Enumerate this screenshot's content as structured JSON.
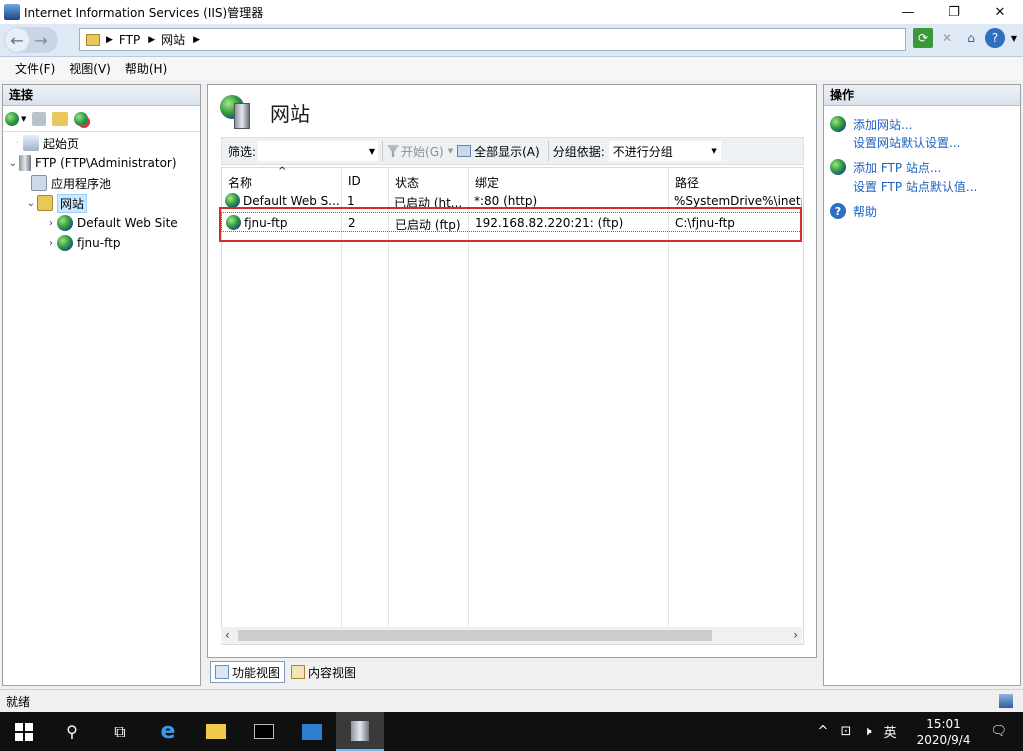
{
  "window": {
    "title": "Internet Information Services (IIS)管理器",
    "controls": {
      "minimize": "—",
      "maximize": "❐",
      "close": "✕"
    }
  },
  "address": {
    "crumbs": [
      "FTP",
      "网站"
    ]
  },
  "menu": {
    "items": [
      "文件(F)",
      "视图(V)",
      "帮助(H)"
    ]
  },
  "connections": {
    "header": "连接",
    "tree": [
      {
        "label": "起始页",
        "level": 1,
        "expander": "",
        "icon": "start-page-icon"
      },
      {
        "label": "FTP (FTP\\Administrator)",
        "level": 0,
        "expander": "⌄",
        "icon": "server-icon"
      },
      {
        "label": "应用程序池",
        "level": 2,
        "expander": "",
        "icon": "app-pool-icon"
      },
      {
        "label": "网站",
        "level": 1,
        "expander": "⌄",
        "icon": "sites-folder-icon",
        "selected": true
      },
      {
        "label": "Default Web Site",
        "level": 2,
        "expander": "›",
        "icon": "globe-icon"
      },
      {
        "label": "fjnu-ftp",
        "level": 2,
        "expander": "›",
        "icon": "globe-icon"
      }
    ]
  },
  "center": {
    "title": "网站",
    "filter": {
      "label": "筛选:",
      "start_label": "开始(G)",
      "show_all_label": "全部显示(A)",
      "group_label": "分组依据:",
      "group_value": "不进行分组"
    },
    "columns": [
      "名称",
      "ID",
      "状态",
      "绑定",
      "路径"
    ],
    "rows": [
      {
        "name": "Default Web S...",
        "id": "1",
        "status": "已启动 (ht...",
        "binding": "*:80 (http)",
        "path": "%SystemDrive%\\inetpu"
      },
      {
        "name": "fjnu-ftp",
        "id": "2",
        "status": "已启动 (ftp)",
        "binding": "192.168.82.220:21: (ftp)",
        "path": "C:\\fjnu-ftp"
      }
    ],
    "view_tabs": [
      "功能视图",
      "内容视图"
    ]
  },
  "actions": {
    "header": "操作",
    "items": [
      {
        "label": "添加网站...",
        "icon": "add-site-icon"
      },
      {
        "label": "设置网站默认设置...",
        "icon": ""
      },
      {
        "label": "添加 FTP 站点...",
        "icon": "add-ftp-icon"
      },
      {
        "label": "设置 FTP 站点默认值...",
        "icon": ""
      },
      {
        "label": "帮助",
        "icon": "help-icon"
      }
    ]
  },
  "status": {
    "text": "就绪"
  },
  "taskbar": {
    "tray_lang": "英",
    "time": "15:01",
    "date": "2020/9/4"
  },
  "colors": {
    "highlight_box": "#d62b2b",
    "link": "#1f5fbf",
    "taskbar": "#101010"
  }
}
